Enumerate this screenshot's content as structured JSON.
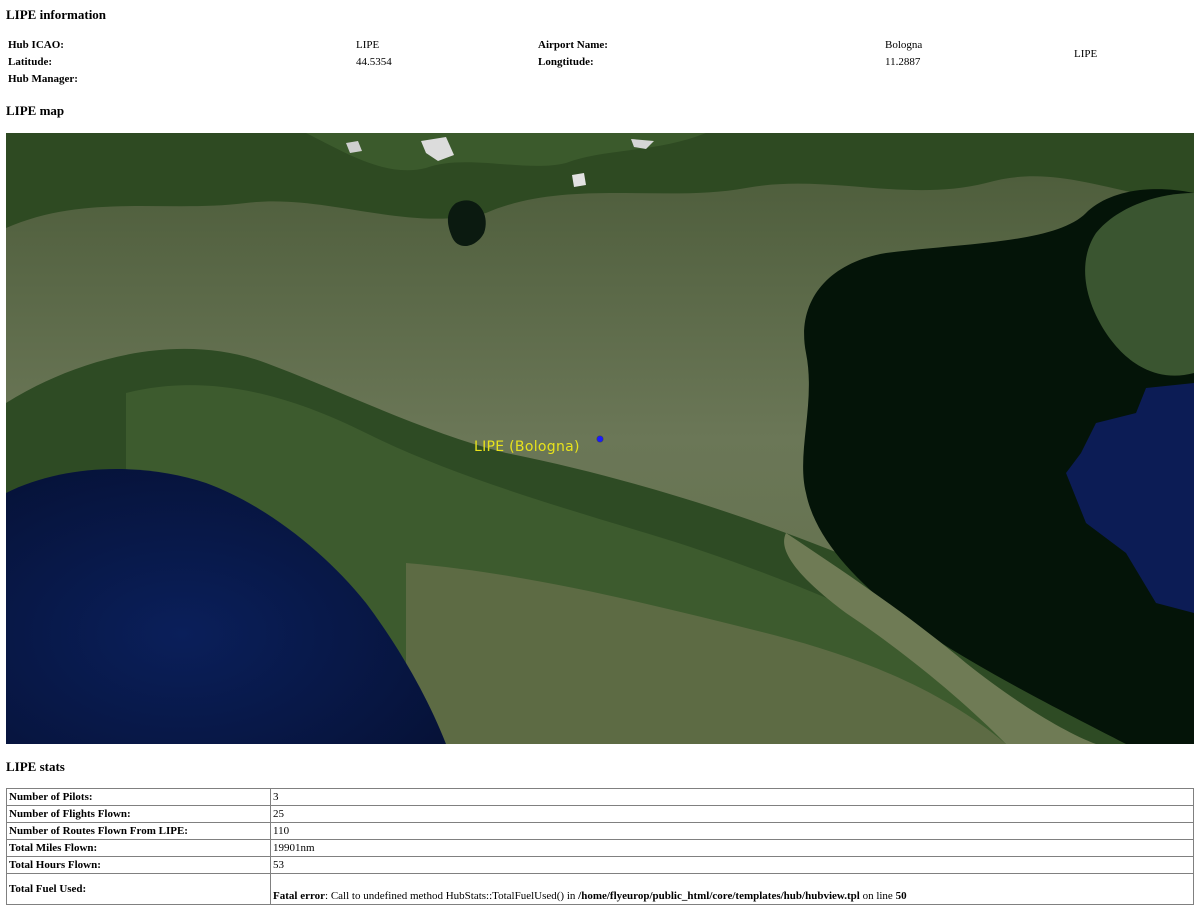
{
  "info": {
    "heading": "LIPE information",
    "hub_icao_label": "Hub ICAO:",
    "hub_icao": "LIPE",
    "airport_name_label": "Airport Name:",
    "airport_name": "Bologna",
    "latitude_label": "Latitude:",
    "latitude": "44.5354",
    "longitude_label": "Longtitude:",
    "longitude": "11.2887",
    "hub_manager_label": "Hub Manager:",
    "side_code": "LIPE"
  },
  "map": {
    "heading": "LIPE map",
    "marker_label": "LIPE (Bologna)",
    "colors": {
      "land": "#5b6a45",
      "mountains": "#2f4a22",
      "sea": "#041408",
      "deep_sea": "#0a1a4a",
      "label": "#e8e31c",
      "marker": "#1a1aff"
    }
  },
  "stats": {
    "heading": "LIPE stats",
    "rows": [
      {
        "label": "Number of Pilots:",
        "value": "3"
      },
      {
        "label": "Number of Flights Flown:",
        "value": "25"
      },
      {
        "label": "Number of Routes Flown From LIPE:",
        "value": "110"
      },
      {
        "label": "Total Miles Flown:",
        "value": "19901nm"
      },
      {
        "label": "Total Hours Flown:",
        "value": "53"
      }
    ],
    "fuel_label": "Total Fuel Used:",
    "error": {
      "prefix": "Fatal error",
      "message": ": Call to undefined method HubStats::TotalFuelUsed() in ",
      "path": "/home/flyeurop/public_html/core/templates/hub/hubview.tpl",
      "line_text": " on line ",
      "line": "50"
    }
  }
}
